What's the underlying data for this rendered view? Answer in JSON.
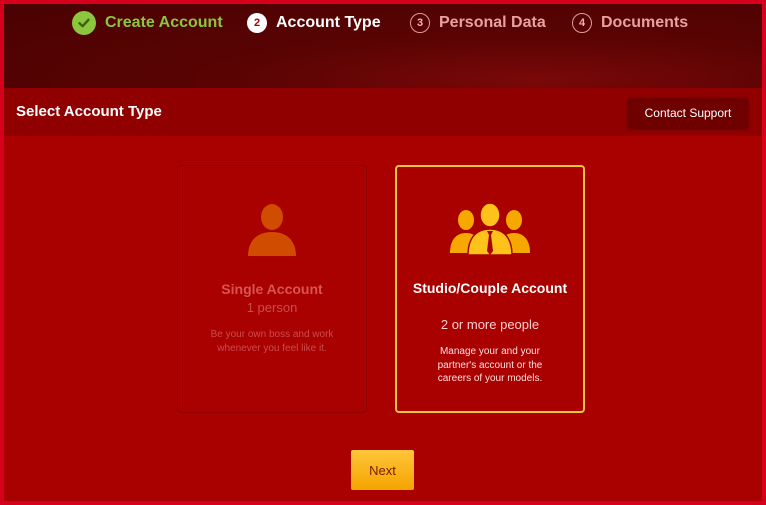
{
  "steps": [
    {
      "label": "Create Account",
      "number": "",
      "state": "done"
    },
    {
      "label": "Account Type",
      "number": "2",
      "state": "active"
    },
    {
      "label": "Personal Data",
      "number": "3",
      "state": "todo"
    },
    {
      "label": "Documents",
      "number": "4",
      "state": "todo"
    }
  ],
  "header": {
    "title": "Select Account Type",
    "contact_label": "Contact Support"
  },
  "cards": {
    "single": {
      "title": "Single Account",
      "subtitle": "1 person",
      "description": "Be your own boss and work whenever you feel like it.",
      "icon": "person-icon"
    },
    "studio": {
      "title": "Studio/Couple Account",
      "subtitle": "2 or more people",
      "description": "Manage your and your partner's account or the careers of your models.",
      "icon": "group-icon"
    }
  },
  "next_label": "Next",
  "colors": {
    "page_bg": "#a90000",
    "accent_yellow": "#f7c340",
    "icon_orange": "#f08a00",
    "step_done": "#8cc63f"
  }
}
